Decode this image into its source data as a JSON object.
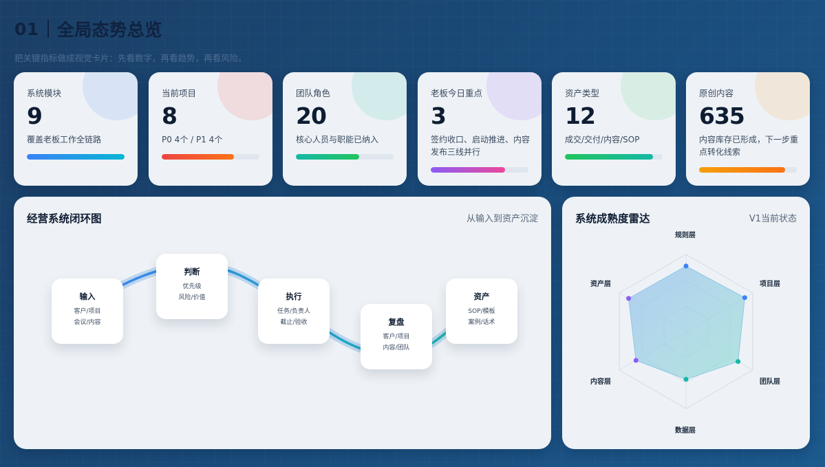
{
  "header": {
    "number": "01",
    "title": "全局态势总览",
    "subtitle": "把关键指标做成视觉卡片：先看数字，再看趋势，再看风险。"
  },
  "cards": [
    {
      "label": "系统模块",
      "value": "9",
      "desc": "覆盖老板工作全链路",
      "progress": 1.0,
      "color_from": "#3b82f6",
      "color_to": "#06b6d4",
      "deco": "#c6d8f5"
    },
    {
      "label": "当前项目",
      "value": "8",
      "desc": "P0 4个 / P1 4个",
      "progress": 0.74,
      "color_from": "#ef4444",
      "color_to": "#f97316",
      "deco": "#f3c9cc"
    },
    {
      "label": "团队角色",
      "value": "20",
      "desc": "核心人员与职能已纳入",
      "progress": 0.65,
      "color_from": "#14b8a6",
      "color_to": "#22c55e",
      "deco": "#bfe5e2"
    },
    {
      "label": "老板今日重点",
      "value": "3",
      "desc": "签约收口、启动推进、内容发布三线并行",
      "progress": 0.76,
      "color_from": "#8b5cf6",
      "color_to": "#ec4899",
      "deco": "#d8cdf5"
    },
    {
      "label": "资产类型",
      "value": "12",
      "desc": "成交/交付/内容/SOP",
      "progress": 0.9,
      "color_from": "#22c55e",
      "color_to": "#14b8a6",
      "deco": "#c6ead6"
    },
    {
      "label": "原创内容",
      "value": "635",
      "desc": "内容库存已形成，下一步重点转化线索",
      "progress": 0.88,
      "color_from": "#f59e0b",
      "color_to": "#f97316",
      "deco": "#f3dfc2"
    }
  ],
  "loop": {
    "title": "经营系统闭环图",
    "note": "从输入到资产沉淀",
    "nodes": [
      {
        "title": "输入",
        "lines": [
          "客户/项目",
          "会议/内容"
        ]
      },
      {
        "title": "判断",
        "lines": [
          "优先级",
          "风险/价值"
        ]
      },
      {
        "title": "执行",
        "lines": [
          "任务/负责人",
          "截止/验收"
        ]
      },
      {
        "title": "复盘",
        "lines": [
          "客户/项目",
          "内容/团队"
        ]
      },
      {
        "title": "资产",
        "lines": [
          "SOP/模板",
          "案例/话术"
        ]
      }
    ]
  },
  "radar": {
    "title": "系统成熟度雷达",
    "note": "V1当前状态",
    "axes": [
      "规则层",
      "项目层",
      "团队层",
      "数据层",
      "内容层",
      "资产层"
    ],
    "values": [
      0.85,
      0.88,
      0.78,
      0.62,
      0.75,
      0.86
    ],
    "point_colors": [
      "#3b82f6",
      "#3b82f6",
      "#14b8a6",
      "#14b8a6",
      "#8b5cf6",
      "#8b5cf6"
    ]
  }
}
